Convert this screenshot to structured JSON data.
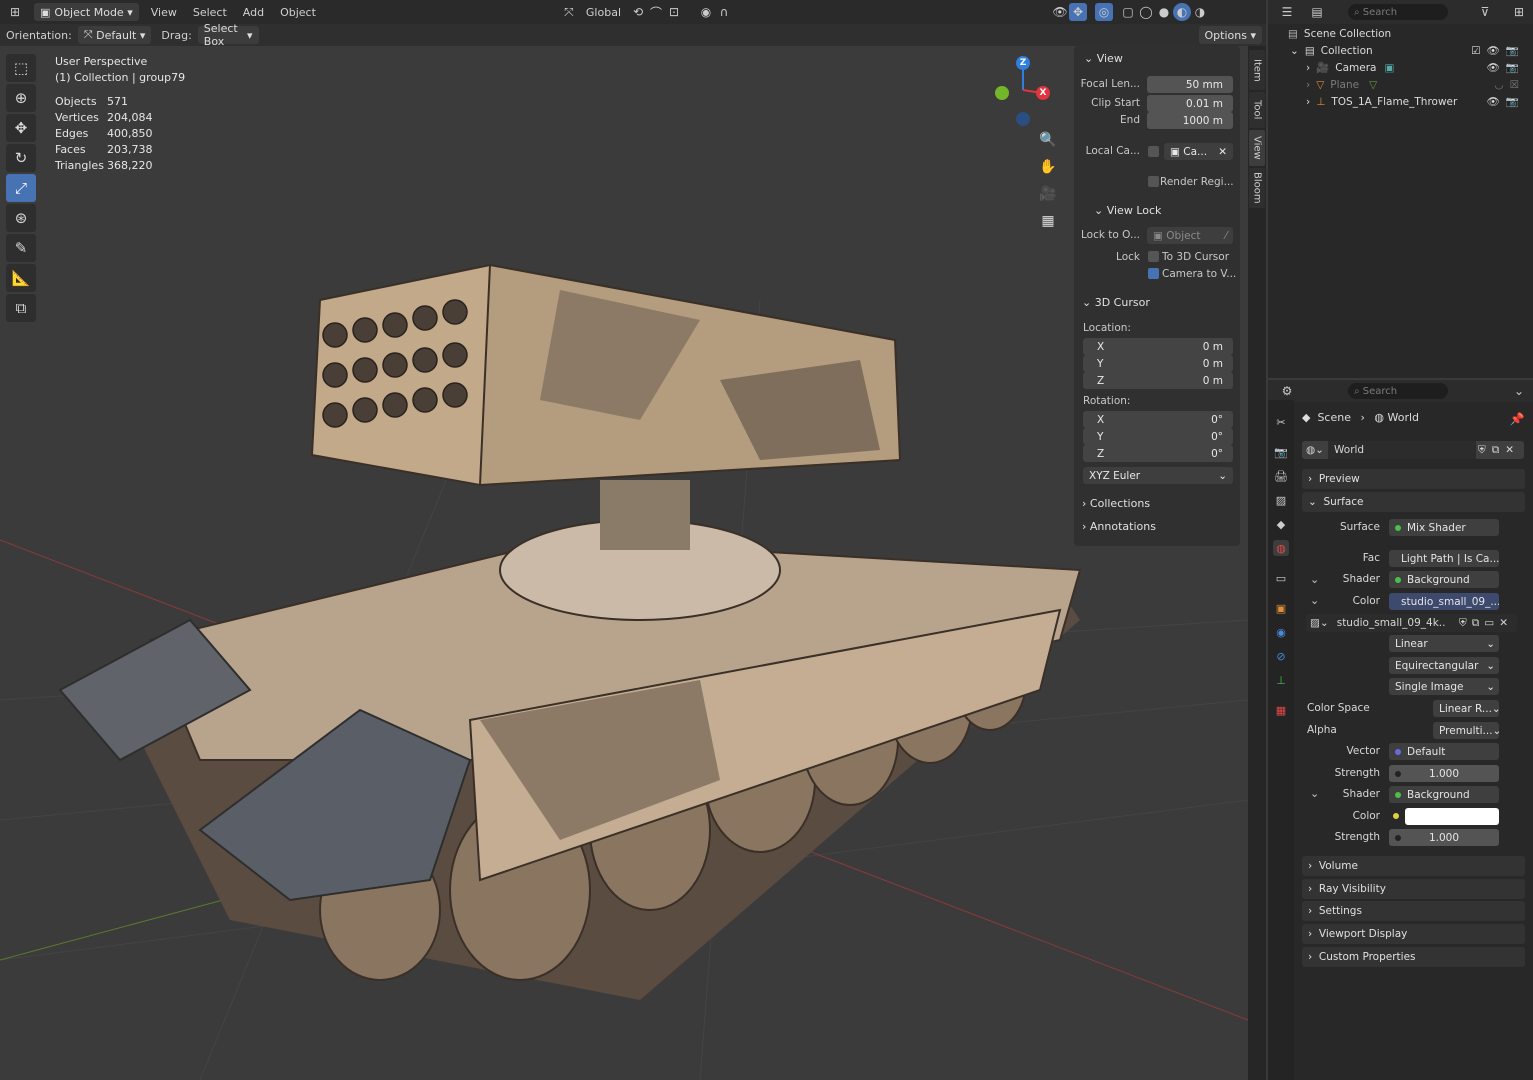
{
  "header": {
    "mode": "Object Mode",
    "menu": [
      "View",
      "Select",
      "Add",
      "Object"
    ],
    "transform_orientation": "Global",
    "orientation_label": "Orientation:",
    "orientation_value": "Default",
    "drag_label": "Drag:",
    "drag_value": "Select Box",
    "options": "Options"
  },
  "viewport": {
    "view_name": "User Perspective",
    "collection": "(1) Collection | group79",
    "stats": [
      {
        "label": "Objects",
        "value": "571"
      },
      {
        "label": "Vertices",
        "value": "204,084"
      },
      {
        "label": "Edges",
        "value": "400,850"
      },
      {
        "label": "Faces",
        "value": "203,738"
      },
      {
        "label": "Triangles",
        "value": "368,220"
      }
    ],
    "gizmo": {
      "z": "Z",
      "x": "X"
    }
  },
  "npanel": {
    "view_header": "View",
    "focal_label": "Focal Len...",
    "focal_value": "50 mm",
    "clip_start_label": "Clip Start",
    "clip_start_value": "0.01 m",
    "end_label": "End",
    "end_value": "1000 m",
    "local_cam_label": "Local Ca...",
    "local_cam_value": "Ca...",
    "render_region": "Render Regi...",
    "view_lock_header": "View Lock",
    "lock_to_label": "Lock to O...",
    "lock_to_value": "Object",
    "lock_label": "Lock",
    "to_cursor": "To 3D Cursor",
    "camera_to_view": "Camera to V...",
    "cursor_header": "3D Cursor",
    "location_label": "Location:",
    "loc_x_label": "X",
    "loc_x": "0 m",
    "loc_y_label": "Y",
    "loc_y": "0 m",
    "loc_z_label": "Z",
    "loc_z": "0 m",
    "rotation_label": "Rotation:",
    "rot_x_label": "X",
    "rot_x": "0°",
    "rot_y_label": "Y",
    "rot_y": "0°",
    "rot_z_label": "Z",
    "rot_z": "0°",
    "rotation_mode": "XYZ Euler",
    "collections": "Collections",
    "annotations": "Annotations",
    "tabs": [
      "Item",
      "Tool",
      "View",
      "Bloom"
    ]
  },
  "outliner": {
    "search_placeholder": "Search",
    "scene_collection": "Scene Collection",
    "items": [
      {
        "name": "Collection"
      },
      {
        "name": "Camera"
      },
      {
        "name": "Plane"
      },
      {
        "name": "TOS_1A_Flame_Thrower"
      }
    ]
  },
  "properties": {
    "search_placeholder": "Search",
    "breadcrumb_scene": "Scene",
    "breadcrumb_world": "World",
    "world_name": "World",
    "preview": "Preview",
    "surface_header": "Surface",
    "surface_label": "Surface",
    "surface_value": "Mix Shader",
    "fac_label": "Fac",
    "fac_value": "Light Path | Is Ca...",
    "shader1_label": "Shader",
    "shader1_value": "Background",
    "color1_label": "Color",
    "color1_value": "studio_small_09_...",
    "image_name": "studio_small_09_4k....",
    "interp": "Linear",
    "projection": "Equirectangular",
    "source": "Single Image",
    "color_space_label": "Color Space",
    "color_space_value": "Linear R...",
    "alpha_label": "Alpha",
    "alpha_value": "Premulti...",
    "vector_label": "Vector",
    "vector_value": "Default",
    "strength1_label": "Strength",
    "strength1_value": "1.000",
    "shader2_label": "Shader",
    "shader2_value": "Background",
    "color2_label": "Color",
    "strength2_label": "Strength",
    "strength2_value": "1.000",
    "volume": "Volume",
    "ray_visibility": "Ray Visibility",
    "settings": "Settings",
    "viewport_display": "Viewport Display",
    "custom_properties": "Custom Properties"
  },
  "colors": {
    "accent": "#4772b3",
    "x_axis": "#e0343f",
    "y_axis": "#74b62a",
    "z_axis": "#2f7fe0"
  }
}
